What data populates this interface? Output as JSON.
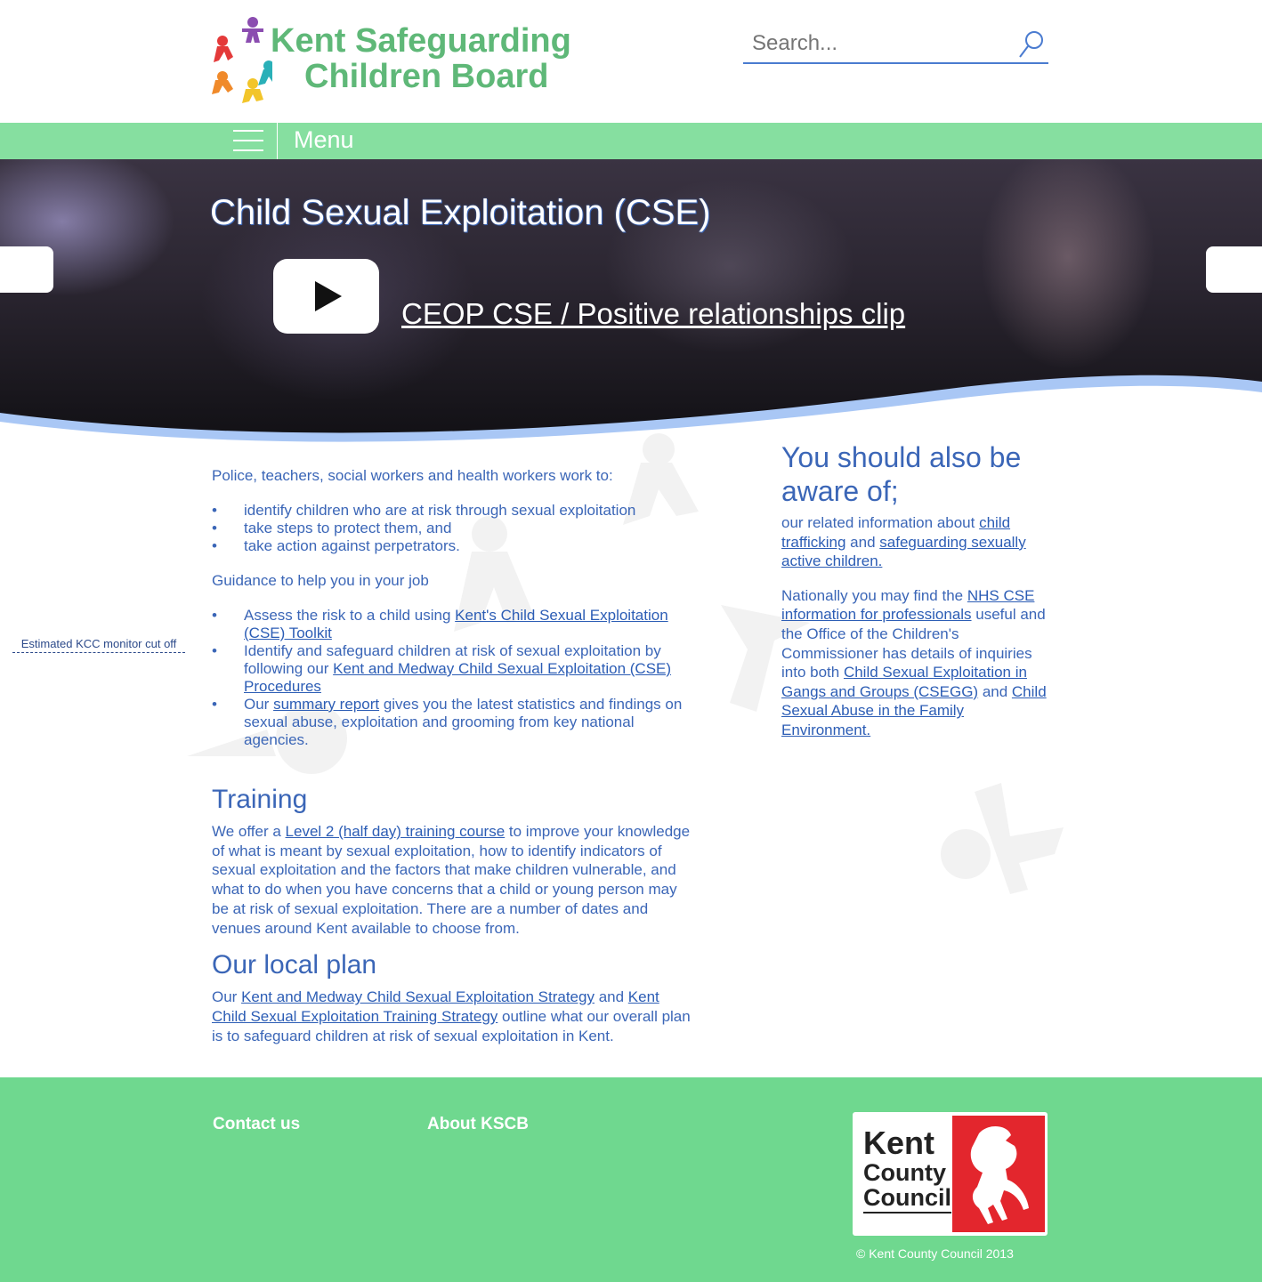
{
  "header": {
    "logo_line1": "Kent Safeguarding",
    "logo_line2": "Children Board",
    "search_placeholder": "Search..."
  },
  "menu": {
    "label": "Menu"
  },
  "hero": {
    "title": "Child Sexual Exploitation (CSE)",
    "video_link": "CEOP CSE / Positive relationships clip"
  },
  "main": {
    "intro": "Police, teachers, social workers and health workers work to:",
    "bullets1": [
      "identify children who are at risk through sexual exploitation",
      "take steps to protect them, and",
      "take action against perpetrators."
    ],
    "guidance": "Guidance to help you in your job",
    "g1_pre": "Assess the risk to a child using ",
    "g1_link": "Kent's Child Sexual Exploitation (CSE) Toolkit",
    "g2_pre": "Identify and safeguard children at risk of sexual exploitation by following our ",
    "g2_link": "Kent and Medway Child Sexual Exploitation (CSE) Procedures",
    "g3_pre": "Our ",
    "g3_link": "summary report",
    "g3_post": " gives you the latest statistics and findings on sexual abuse, exploitation and grooming from key national agencies.",
    "training_heading": "Training",
    "training_pre": "We offer a ",
    "training_link": "Level 2 (half day) training course",
    "training_post": " to improve your knowledge of what is meant by sexual exploitation, how to identify indicators of sexual exploitation and the factors that make children vulnerable, and what to do when you have concerns that a child or young person may be at risk of sexual exploitation. There are a number of dates and venues around Kent available to choose from.",
    "plan_heading": "Our local plan",
    "plan_pre": "Our ",
    "plan_link1": "Kent and Medway Child Sexual Exploitation Strategy",
    "plan_mid": " and ",
    "plan_link2": "Kent Child Sexual Exploitation Training Strategy",
    "plan_post": " outline what our overall plan is to safeguard children at risk of sexual exploitation in Kent."
  },
  "sidebar": {
    "heading": "You should also be aware of;",
    "p1_pre": " our related information about ",
    "p1_link1": "child trafficking",
    "p1_mid": " and ",
    "p1_link2": "safeguarding sexually active children.",
    "p2_pre": "Nationally you may find the ",
    "p2_link1": "NHS CSE information for professionals",
    "p2_mid1": " useful and the Office of the Children's Commissioner has details of inquiries into both ",
    "p2_link2": "Child Sexual Exploitation in Gangs and Groups (CSEGG)",
    "p2_mid2": " and ",
    "p2_link3": "Child Sexual Abuse in the Family Environment."
  },
  "note": "Estimated KCC monitor cut off",
  "footer": {
    "contact": "Contact us",
    "about": "About KSCB",
    "kcc_line1": "Kent",
    "kcc_line2": "County",
    "kcc_line3": "Council",
    "copyright": "© Kent County Council 2013"
  },
  "colors": {
    "brand_green": "#5fb878",
    "menu_green": "#86dfa0",
    "footer_green": "#6fd88f",
    "text_blue": "#3b66b7",
    "kcc_red": "#e3262d"
  }
}
